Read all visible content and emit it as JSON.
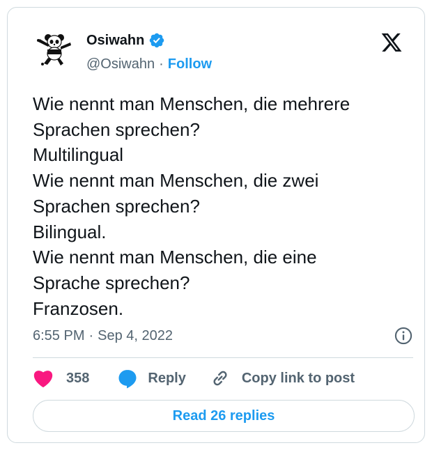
{
  "author": {
    "display_name": "Osiwahn",
    "handle": "@Osiwahn",
    "separator": "·",
    "follow_label": "Follow",
    "verified": true
  },
  "tweet": {
    "lines": [
      "Wie nennt man Menschen, die mehrere",
      "Sprachen sprechen?",
      "Multilingual",
      "Wie nennt man Menschen, die zwei",
      "Sprachen sprechen?",
      "Bilingual.",
      "Wie nennt man Menschen, die eine",
      "Sprache sprechen?",
      "Franzosen."
    ],
    "time": "6:55 PM",
    "separator": "·",
    "date": "Sep 4, 2022"
  },
  "actions": {
    "like_count": "358",
    "reply_label": "Reply",
    "copy_label": "Copy link to post"
  },
  "footer": {
    "read_replies_label": "Read 26 replies"
  },
  "icons": {
    "logo": "x-logo-icon",
    "verified": "verified-badge-icon",
    "info": "info-icon",
    "like": "heart-icon",
    "reply": "speech-bubble-icon",
    "copy": "link-icon"
  },
  "colors": {
    "accent": "#1d9bf0",
    "like": "#f91880",
    "text": "#0f1419",
    "muted": "#536471",
    "border": "#cfd9de"
  }
}
